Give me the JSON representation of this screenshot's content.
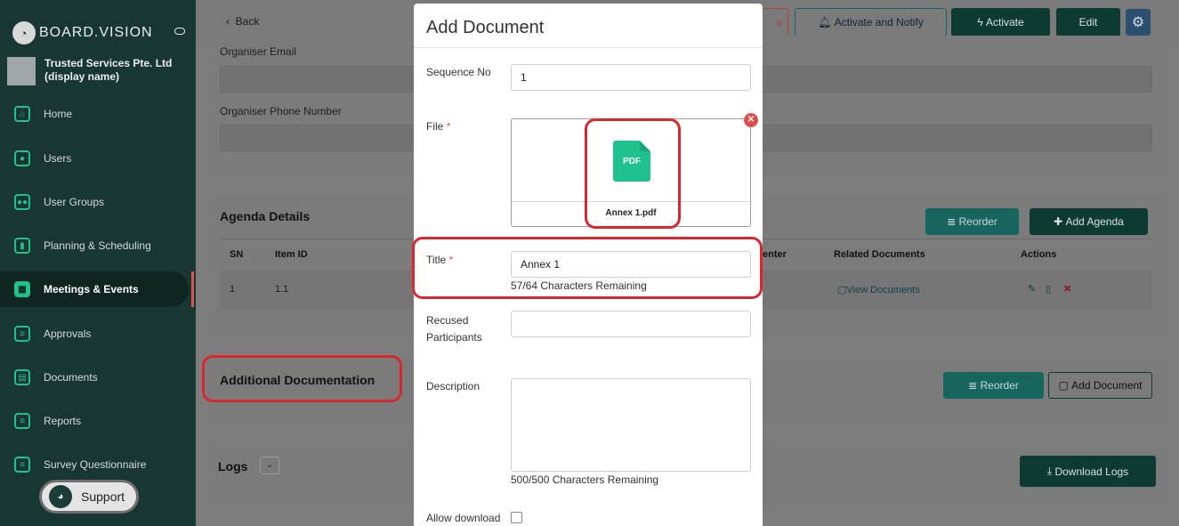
{
  "sidebar": {
    "brand": "BOARD.VISION",
    "org_name": "Trusted Services Pte. Ltd (display name)",
    "items": [
      {
        "label": "Home",
        "icon": "home-icon"
      },
      {
        "label": "Users",
        "icon": "user-icon"
      },
      {
        "label": "User Groups",
        "icon": "users-icon"
      },
      {
        "label": "Planning & Scheduling",
        "icon": "chart-icon"
      },
      {
        "label": "Meetings & Events",
        "icon": "calendar-icon",
        "active": true
      },
      {
        "label": "Approvals",
        "icon": "approvals-icon"
      },
      {
        "label": "Documents",
        "icon": "documents-icon"
      },
      {
        "label": "Reports",
        "icon": "reports-icon"
      },
      {
        "label": "Survey Questionnaire",
        "icon": "survey-icon"
      }
    ],
    "support_label": "Support"
  },
  "header": {
    "back_label": "Back",
    "partial_button_label": "e",
    "activate_notify_label": "Activate and Notify",
    "activate_label": "Activate",
    "edit_label": "Edit"
  },
  "form": {
    "organiser_email_label": "Organiser Email",
    "organiser_phone_label": "Organiser Phone Number"
  },
  "agenda": {
    "title": "Agenda Details",
    "reorder_label": "Reorder",
    "add_label": "Add Agenda",
    "columns": [
      "SN",
      "Item ID",
      "enter",
      "Related Documents",
      "Actions"
    ],
    "rows": [
      {
        "sn": "1",
        "item_id": "1.1",
        "related": "View Documents"
      }
    ]
  },
  "additional": {
    "title": "Additional Documentation",
    "reorder_label": "Reorder",
    "add_label": "Add Document"
  },
  "logs": {
    "title": "Logs",
    "download_label": "Download Logs"
  },
  "modal": {
    "title": "Add Document",
    "sequence_label": "Sequence No",
    "sequence_value": "1",
    "file_label": "File",
    "required_mark": "*",
    "file_name": "Annex 1.pdf",
    "file_type": "PDF",
    "title_label": "Title",
    "title_value": "Annex 1",
    "title_hint": "57/64 Characters Remaining",
    "recused_label": "Recused Participants",
    "description_label": "Description",
    "description_hint": "500/500 Characters Remaining",
    "allow_download_label": "Allow download"
  },
  "colors": {
    "accent": "#1fc18e",
    "sidebar_bg": "#183632",
    "teal_button": "#16665f",
    "dark_button": "#0e3b31",
    "highlight": "#d8282f"
  }
}
